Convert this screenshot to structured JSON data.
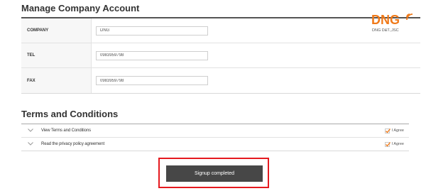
{
  "account": {
    "title": "Manage Company Account",
    "fields": [
      {
        "label": "COMPANY",
        "value": "DNG"
      },
      {
        "label": "TEL",
        "value": "0983959798"
      },
      {
        "label": "FAX",
        "value": "0983959798"
      }
    ]
  },
  "logo": {
    "text": "DNG",
    "subtitle": "DNG D&T.,JSC",
    "color": "#f07a1a"
  },
  "terms": {
    "title": "Terms and Conditions",
    "items": [
      {
        "label": "View Terms and Conditions",
        "agree_label": "I Agree",
        "checked": true
      },
      {
        "label": "Read the privacy policy agreement",
        "agree_label": "I Agree",
        "checked": true
      }
    ]
  },
  "actions": {
    "signup_label": "Signup completed",
    "highlight_color": "#e5191f",
    "button_color": "#474747"
  }
}
